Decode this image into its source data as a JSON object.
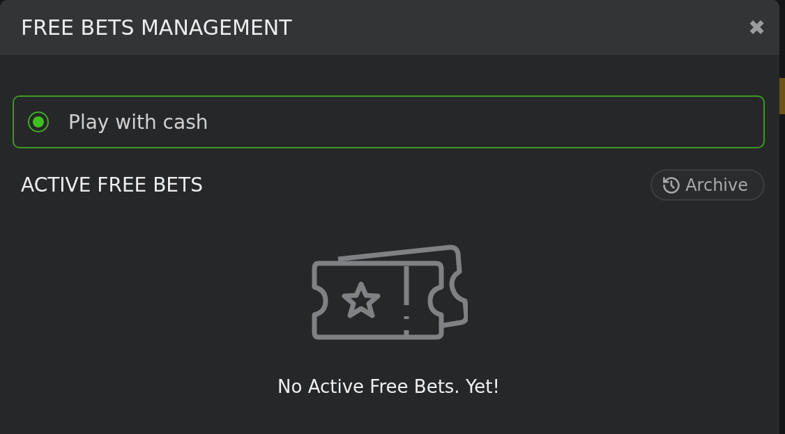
{
  "dialog": {
    "title": "FREE BETS MANAGEMENT",
    "close": "✖"
  },
  "cash_option": {
    "label": "Play with cash",
    "selected": true
  },
  "section": {
    "title": "ACTIVE FREE BETS",
    "archive_button": "Archive"
  },
  "empty_state": {
    "message": "No Active Free Bets. Yet!"
  }
}
